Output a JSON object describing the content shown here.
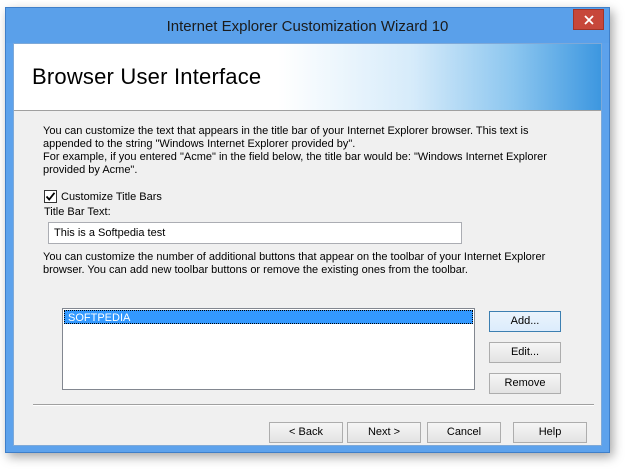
{
  "window": {
    "title": "Internet Explorer Customization Wizard 10"
  },
  "header": {
    "title": "Browser User Interface"
  },
  "title_section": {
    "description_lines": [
      "You can customize the text that appears in the title bar of your Internet Explorer browser. This text is",
      "appended to the string \"Windows Internet Explorer provided by\".",
      "For example, if you entered \"Acme\" in the field below, the title bar would be: \"Windows Internet Explorer",
      "provided by Acme\"."
    ],
    "checkbox_label": "Customize Title Bars",
    "checkbox_checked": true,
    "field_label": "Title Bar Text:",
    "field_value": "This is a Softpedia test"
  },
  "toolbar_section": {
    "description_lines": [
      "You can customize the number of additional buttons that appear on the toolbar of your Internet Explorer",
      "browser. You can add new toolbar buttons or remove the existing ones from the toolbar."
    ],
    "list_items": [
      "SOFTPEDIA"
    ],
    "add_label": "Add...",
    "edit_label": "Edit...",
    "remove_label": "Remove"
  },
  "footer": {
    "back_label": "< Back",
    "next_label": "Next >",
    "cancel_label": "Cancel",
    "help_label": "Help"
  },
  "icons": {
    "close": "close-icon",
    "checkmark": "checkmark-icon"
  },
  "colors": {
    "titlebar": "#5aa0ea",
    "close_button": "#c7473a",
    "selection": "#3399ff"
  }
}
